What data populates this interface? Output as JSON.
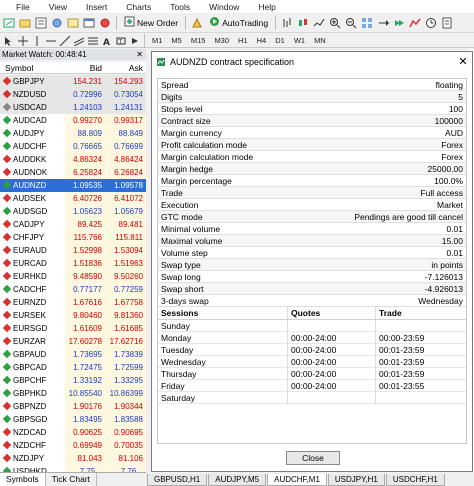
{
  "menu": [
    "File",
    "View",
    "Insert",
    "Charts",
    "Tools",
    "Window",
    "Help"
  ],
  "toolbar": {
    "new_order": "New Order",
    "autotrading": "AutoTrading"
  },
  "timeframes": [
    "M1",
    "M5",
    "M15",
    "M30",
    "H1",
    "H4",
    "D1",
    "W1",
    "MN"
  ],
  "market_watch": {
    "title": "Market Watch: 00:48:41",
    "columns": {
      "symbol": "Symbol",
      "bid": "Bid",
      "ask": "Ask"
    },
    "rows": [
      {
        "symbol": "GBPJPY",
        "bid": "154.231",
        "ask": "154.293"
      },
      {
        "symbol": "NZDUSD",
        "bid": "0.72996",
        "ask": "0.73054"
      },
      {
        "symbol": "USDCAD",
        "bid": "1.24103",
        "ask": "1.24131"
      },
      {
        "symbol": "AUDCAD",
        "bid": "0.99270",
        "ask": "0.99317"
      },
      {
        "symbol": "AUDJPY",
        "bid": "88.809",
        "ask": "88.849"
      },
      {
        "symbol": "AUDCHF",
        "bid": "0.76665",
        "ask": "0.76699"
      },
      {
        "symbol": "AUDDKK",
        "bid": "4.86324",
        "ask": "4.86424"
      },
      {
        "symbol": "AUDNOK",
        "bid": "6.25824",
        "ask": "6.26824"
      },
      {
        "symbol": "AUDNZD",
        "bid": "1.09535",
        "ask": "1.09578"
      },
      {
        "symbol": "AUDSEK",
        "bid": "6.40726",
        "ask": "6.41072"
      },
      {
        "symbol": "AUDSGD",
        "bid": "1.05623",
        "ask": "1.05679"
      },
      {
        "symbol": "CADJPY",
        "bid": "89.425",
        "ask": "89.481"
      },
      {
        "symbol": "CHFJPY",
        "bid": "115.766",
        "ask": "115.811"
      },
      {
        "symbol": "EURAUD",
        "bid": "1.52998",
        "ask": "1.53094"
      },
      {
        "symbol": "EURCAD",
        "bid": "1.51836",
        "ask": "1.51963"
      },
      {
        "symbol": "EURHKD",
        "bid": "9.48590",
        "ask": "9.50260"
      },
      {
        "symbol": "CADCHF",
        "bid": "0.77177",
        "ask": "0.77259"
      },
      {
        "symbol": "EURNZD",
        "bid": "1.67616",
        "ask": "1.67758"
      },
      {
        "symbol": "EURSEK",
        "bid": "9.80460",
        "ask": "9.81360"
      },
      {
        "symbol": "EURSGD",
        "bid": "1.61609",
        "ask": "1.61685"
      },
      {
        "symbol": "EURZAR",
        "bid": "17.60278",
        "ask": "17.62716"
      },
      {
        "symbol": "GBPAUD",
        "bid": "1.73695",
        "ask": "1.73839"
      },
      {
        "symbol": "GBPCAD",
        "bid": "1.72475",
        "ask": "1.72599"
      },
      {
        "symbol": "GBPCHF",
        "bid": "1.33192",
        "ask": "1.33295"
      },
      {
        "symbol": "GBPHKD",
        "bid": "10.85540",
        "ask": "10.86399"
      },
      {
        "symbol": "GBPNZD",
        "bid": "1.90176",
        "ask": "1.90344"
      },
      {
        "symbol": "GBPSGD",
        "bid": "1.83495",
        "ask": "1.83588"
      },
      {
        "symbol": "NZDCAD",
        "bid": "0.90625",
        "ask": "0.90695"
      },
      {
        "symbol": "NZDCHF",
        "bid": "0.69949",
        "ask": "0.70035"
      },
      {
        "symbol": "NZDJPY",
        "bid": "81.043",
        "ask": "81.106"
      },
      {
        "symbol": "USDHKD",
        "bid": "7.75...",
        "ask": "7.76..."
      }
    ]
  },
  "bottom_tabs": [
    "Symbols",
    "Tick Chart"
  ],
  "chart_tabs": [
    "GBPUSD,H1",
    "AUDJPY,M5",
    "AUDCHF,M1",
    "USDJPY,H1",
    "USDCHF,H1"
  ],
  "dialog": {
    "title": "AUDNZD contract specification",
    "specs": [
      {
        "k": "Spread",
        "v": "floating"
      },
      {
        "k": "Digits",
        "v": "5"
      },
      {
        "k": "Stops level",
        "v": "100"
      },
      {
        "k": "Contract size",
        "v": "100000"
      },
      {
        "k": "Margin currency",
        "v": "AUD"
      },
      {
        "k": "Profit calculation mode",
        "v": "Forex"
      },
      {
        "k": "Margin calculation mode",
        "v": "Forex"
      },
      {
        "k": "Margin hedge",
        "v": "25000.00"
      },
      {
        "k": "Margin percentage",
        "v": "100.0%"
      },
      {
        "k": "Trade",
        "v": "Full access"
      },
      {
        "k": "Execution",
        "v": "Market"
      },
      {
        "k": "GTC mode",
        "v": "Pendings are good till cancel"
      },
      {
        "k": "Minimal volume",
        "v": "0.01"
      },
      {
        "k": "Maximal volume",
        "v": "15.00"
      },
      {
        "k": "Volume step",
        "v": "0.01"
      },
      {
        "k": "Swap type",
        "v": "in points"
      },
      {
        "k": "Swap long",
        "v": "-7.126013"
      },
      {
        "k": "Swap short",
        "v": "-4.926013"
      },
      {
        "k": "3-days swap",
        "v": "Wednesday"
      }
    ],
    "sessions_header": {
      "sessions": "Sessions",
      "quotes": "Quotes",
      "trade": "Trade"
    },
    "sessions": [
      {
        "day": "Sunday",
        "quotes": "",
        "trade": ""
      },
      {
        "day": "Monday",
        "quotes": "00:00-24:00",
        "trade": "00:00-23:59"
      },
      {
        "day": "Tuesday",
        "quotes": "00:00-24:00",
        "trade": "00:01-23:59"
      },
      {
        "day": "Wednesday",
        "quotes": "00:00-24:00",
        "trade": "00:01-23:59"
      },
      {
        "day": "Thursday",
        "quotes": "00:00-24:00",
        "trade": "00:01-23:59"
      },
      {
        "day": "Friday",
        "quotes": "00:00-24:00",
        "trade": "00:01-23:55"
      },
      {
        "day": "Saturday",
        "quotes": "",
        "trade": ""
      }
    ],
    "close_label": "Close"
  }
}
